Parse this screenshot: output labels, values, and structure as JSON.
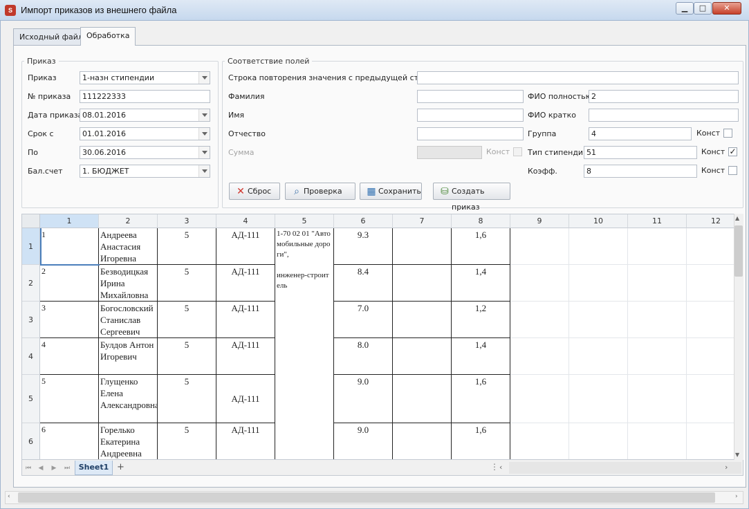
{
  "window": {
    "title": "Импорт приказов из внешнего файла",
    "app_icon": "S"
  },
  "tabs": [
    {
      "label": "Исходный файл"
    },
    {
      "label": "Обработка"
    }
  ],
  "order_group": {
    "legend": "Приказ",
    "order_label": "Приказ",
    "order_value": "1-назн стипендии",
    "number_label": "№ приказа",
    "number_value": "111222333",
    "date_label": "Дата приказа",
    "date_value": "08.01.2016",
    "from_label": "Срок с",
    "from_value": "01.01.2016",
    "to_label": "По",
    "to_value": "30.06.2016",
    "account_label": "Бал.счет",
    "account_value": "1. БЮДЖЕТ"
  },
  "mapping_group": {
    "legend": "Соответствие полей",
    "repeat_label": "Строка повторения значения с предыдущей строки",
    "repeat_value": "",
    "surname_label": "Фамилия",
    "surname_value": "",
    "name_label": "Имя",
    "name_value": "",
    "patronymic_label": "Отчество",
    "patronymic_value": "",
    "sum_label": "Сумма",
    "sum_value": "",
    "sum_const_label": "Конст",
    "fullname_label": "ФИО полностью",
    "fullname_value": "2",
    "shortname_label": "ФИО кратко",
    "shortname_value": "",
    "group_label": "Группа",
    "group_value": "4",
    "group_const_label": "Конст",
    "type_label": "Тип стипендии",
    "type_value": "51",
    "type_const_label": "Конст",
    "type_const_checked": "✓",
    "coef_label": "Коэфф.",
    "coef_value": "8",
    "coef_const_label": "Конст"
  },
  "buttons": {
    "reset": "Сброс",
    "check": "Проверка",
    "save": "Сохранить",
    "create": "Создать приказ"
  },
  "grid": {
    "columns": [
      "1",
      "2",
      "3",
      "4",
      "5",
      "6",
      "7",
      "8",
      "9",
      "10",
      "11",
      "12"
    ],
    "rows": [
      "1",
      "2",
      "3",
      "4",
      "5",
      "6"
    ],
    "data": [
      [
        "1",
        "Андреева Анастасия Игоревна",
        "5",
        "АД-111",
        "",
        "9.3",
        "",
        "1,6"
      ],
      [
        "2",
        "Безводицкая Ирина Михайловна",
        "5",
        "АД-111",
        "",
        "8.4",
        "",
        "1,4"
      ],
      [
        "3",
        "Богословский Станислав Сергеевич",
        "5",
        "АД-111",
        "",
        "7.0",
        "",
        "1,2"
      ],
      [
        "4",
        "Булдов Антон Игоревич",
        "5",
        "АД-111",
        "",
        "8.0",
        "",
        "1,4"
      ],
      [
        "5",
        "Глущенко Елена Александровна",
        "5",
        "АД-111",
        "",
        "9.0",
        "",
        "1,6"
      ],
      [
        "6",
        "Горелько Екатерина Андреевна",
        "5",
        "АД-111",
        "",
        "9.0",
        "",
        "1,6"
      ]
    ],
    "merged_col5": "1-70 02 01 \"Автомобильные дороги\",\n\nинженер-строитель"
  },
  "sheet_tab": "Sheet1",
  "sheet_add": "+"
}
